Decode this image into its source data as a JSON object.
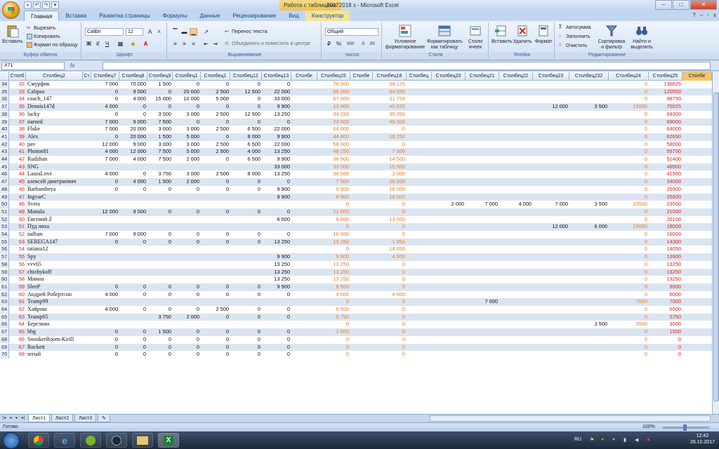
{
  "window": {
    "title": "20172018 з - Microsoft Excel",
    "context_tab_title": "Работа с таблицами",
    "controls": [
      "–",
      "□",
      "✕"
    ]
  },
  "ribbon_tabs": [
    "Главная",
    "Вставка",
    "Разметка страницы",
    "Формулы",
    "Данные",
    "Рецензирование",
    "Вид",
    "Конструктор"
  ],
  "ribbon": {
    "clipboard": {
      "paste": "Вставить",
      "cut": "Вырезать",
      "copy": "Копировать",
      "format_painter": "Формат по образцу",
      "group": "Буфер обмена"
    },
    "font": {
      "name": "Calibri",
      "size": "12",
      "bold": "Ж",
      "italic": "К",
      "underline": "Ч",
      "group": "Шрифт"
    },
    "alignment": {
      "wrap": "Перенос текста",
      "merge": "Объединить и поместить в центре",
      "group": "Выравнивание"
    },
    "number": {
      "format": "Общий",
      "group": "Число",
      "percent": "%",
      "thousands": "000"
    },
    "styles": {
      "conditional": "Условное форматирование",
      "as_table": "Форматировать как таблицу",
      "cell_styles": "Стили ячеек",
      "group": "Стили"
    },
    "cells": {
      "insert": "Вставить",
      "delete": "Удалить",
      "format": "Формат",
      "group": "Ячейки"
    },
    "editing": {
      "autosum": "Автосумма",
      "fill": "Заполнить",
      "clear": "Очистить",
      "sort": "Сортировка и фильтр",
      "find": "Найти и выделить",
      "group": "Редактирование"
    }
  },
  "formula_bar": {
    "name_box": "X71",
    "fx": "fx",
    "content": ""
  },
  "columns": [
    "Столб",
    "Столбец2",
    "Ст",
    "Столбец7",
    "Столбец8",
    "Столбец9",
    "Столбец1",
    "Столбец1",
    "Столбец12",
    "Столбец13",
    "Столбе",
    "Столбец15",
    "Столбе",
    "Столбец18",
    "Столбец",
    "Столбец20",
    "Столбец21",
    "Столбец22",
    "Столбец23",
    "Столбец232",
    "Столбец24",
    "Столбец25",
    "Столбе"
  ],
  "rows": [
    {
      "r": "34",
      "n": "32",
      "name": "Смурфик",
      "c7": "7 000",
      "c8": "70 000",
      "c9": "1 500",
      "c10": "0",
      "c11": "0",
      "c12": "0",
      "c13": "0",
      "c15": "78 500",
      "c18": "58 125",
      "c21": "",
      "c22": "",
      "c23": "",
      "c232": "",
      "c24": "0",
      "c25": "136625"
    },
    {
      "r": "35",
      "n": "33",
      "name": "Calipso",
      "c7": "0",
      "c8": "9 000",
      "c9": "0",
      "c10": "20 000",
      "c11": "2 500",
      "c12": "12 500",
      "c13": "22 000",
      "c15": "66 000",
      "c18": "54 550",
      "c21": "",
      "c22": "",
      "c23": "",
      "c232": "",
      "c24": "0",
      "c25": "120550"
    },
    {
      "r": "36",
      "n": "34",
      "name": "coach_147",
      "c7": "0",
      "c8": "4 000",
      "c9": "15 000",
      "c10": "10 000",
      "c11": "5 000",
      "c12": "0",
      "c13": "33 000",
      "c15": "67 000",
      "c18": "31 750",
      "c21": "",
      "c22": "",
      "c23": "",
      "c232": "",
      "c24": "0",
      "c25": "98750"
    },
    {
      "r": "37",
      "n": "35",
      "name": "Dennis147d",
      "c7": "4 000",
      "c8": "0",
      "c9": "0",
      "c10": "0",
      "c11": "0",
      "c12": "0",
      "c13": "9 900",
      "c15": "13 900",
      "c18": "45 625",
      "c21": "",
      "c22": "",
      "c23": "12 000",
      "c232": "3 500",
      "c24": "15500",
      "c25": "75025"
    },
    {
      "r": "38",
      "n": "36",
      "name": "lucky",
      "c7": "0",
      "c8": "0",
      "c9": "3 000",
      "c10": "3 000",
      "c11": "2 500",
      "c12": "12 500",
      "c13": "13 250",
      "c15": "34 250",
      "c18": "35 050",
      "c21": "",
      "c22": "",
      "c23": "",
      "c232": "",
      "c24": "0",
      "c25": "69300"
    },
    {
      "r": "39",
      "n": "37",
      "name": "narned",
      "c7": "7 000",
      "c8": "9 000",
      "c9": "7 500",
      "c10": "0",
      "c11": "0",
      "c12": "0",
      "c13": "0",
      "c15": "23 500",
      "c18": "45 500",
      "c21": "",
      "c22": "",
      "c23": "",
      "c232": "",
      "c24": "0",
      "c25": "69000"
    },
    {
      "r": "40",
      "n": "38",
      "name": "Fluke",
      "c7": "7 000",
      "c8": "20 000",
      "c9": "3 000",
      "c10": "3 000",
      "c11": "2 500",
      "c12": "6 500",
      "c13": "22 000",
      "c15": "64 000",
      "c18": "0",
      "c21": "",
      "c22": "",
      "c23": "",
      "c232": "",
      "c24": "0",
      "c25": "64000"
    },
    {
      "r": "41",
      "n": "39",
      "name": "Alex",
      "c7": "0",
      "c8": "20 000",
      "c9": "1 500",
      "c10": "5 000",
      "c11": "0",
      "c12": "8 000",
      "c13": "9 900",
      "c15": "44 400",
      "c18": "18 250",
      "c21": "",
      "c22": "",
      "c23": "",
      "c232": "",
      "c24": "0",
      "c25": "62650"
    },
    {
      "r": "42",
      "n": "40",
      "name": "pav",
      "c7": "12 000",
      "c8": "9 000",
      "c9": "3 000",
      "c10": "3 000",
      "c11": "2 500",
      "c12": "6 500",
      "c13": "22 000",
      "c15": "58 000",
      "c18": "0",
      "c21": "",
      "c22": "",
      "c23": "",
      "c232": "",
      "c24": "0",
      "c25": "58000"
    },
    {
      "r": "43",
      "n": "41",
      "name": "Photon81",
      "c7": "4 000",
      "c8": "12 000",
      "c9": "7 500",
      "c10": "5 000",
      "c11": "2 500",
      "c12": "4 000",
      "c13": "13 250",
      "c15": "48 250",
      "c18": "7 500",
      "c21": "",
      "c22": "",
      "c23": "",
      "c232": "",
      "c24": "0",
      "c25": "55750"
    },
    {
      "r": "44",
      "n": "42",
      "name": "Rudzhan",
      "c7": "7 000",
      "c8": "4 000",
      "c9": "7 500",
      "c10": "2 000",
      "c11": "0",
      "c12": "6 500",
      "c13": "9 900",
      "c15": "36 900",
      "c18": "14 500",
      "c21": "",
      "c22": "",
      "c23": "",
      "c232": "",
      "c24": "0",
      "c25": "51400"
    },
    {
      "r": "45",
      "n": "43",
      "name": "SNG",
      "c7": "",
      "c8": "",
      "c9": "",
      "c10": "",
      "c11": "",
      "c12": "",
      "c13": "33 000",
      "c15": "33 000",
      "c18": "15 500",
      "c21": "",
      "c22": "",
      "c23": "",
      "c232": "",
      "c24": "0",
      "c25": "48500"
    },
    {
      "r": "46",
      "n": "44",
      "name": "LauraLove",
      "c7": "4 000",
      "c8": "0",
      "c9": "3 750",
      "c10": "3 000",
      "c11": "2 500",
      "c12": "8 000",
      "c13": "13 250",
      "c15": "38 500",
      "c18": "3 000",
      "c21": "",
      "c22": "",
      "c23": "",
      "c232": "",
      "c24": "0",
      "c25": "41500"
    },
    {
      "r": "47",
      "n": "45",
      "name": "алексей дмитриевич",
      "c7": "0",
      "c8": "4 000",
      "c9": "1 500",
      "c10": "2 000",
      "c11": "0",
      "c12": "0",
      "c13": "0",
      "c15": "7 500",
      "c18": "26 500",
      "c21": "",
      "c22": "",
      "c23": "",
      "c232": "",
      "c24": "0",
      "c25": "34000"
    },
    {
      "r": "48",
      "n": "46",
      "name": "Barbambeya",
      "c7": "0",
      "c8": "0",
      "c9": "0",
      "c10": "0",
      "c11": "0",
      "c12": "0",
      "c13": "9 900",
      "c15": "9 900",
      "c18": "16 000",
      "c21": "",
      "c22": "",
      "c23": "",
      "c232": "",
      "c24": "0",
      "c25": "25900"
    },
    {
      "r": "49",
      "n": "47",
      "name": "IngvarC",
      "c7": "",
      "c8": "",
      "c9": "",
      "c10": "",
      "c11": "",
      "c12": "",
      "c13": "9 900",
      "c15": "9 900",
      "c18": "16 000",
      "c21": "",
      "c22": "",
      "c23": "",
      "c232": "",
      "c24": "0",
      "c25": "25900"
    },
    {
      "r": "50",
      "n": "48",
      "name": "Sveta",
      "c7": "",
      "c8": "",
      "c9": "",
      "c10": "",
      "c11": "",
      "c12": "",
      "c13": "",
      "c15": "0",
      "c18": "0",
      "c20": "2 000",
      "c21": "7 000",
      "c22": "4 000",
      "c23": "7 000",
      "c232": "3 500",
      "c24": "23500",
      "c25": "23500"
    },
    {
      "r": "51",
      "n": "49",
      "name": "Manula",
      "c7": "12 000",
      "c8": "9 000",
      "c9": "0",
      "c10": "0",
      "c11": "0",
      "c12": "0",
      "c13": "0",
      "c15": "21 000",
      "c18": "0",
      "c21": "",
      "c22": "",
      "c23": "",
      "c232": "",
      "c24": "0",
      "c25": "21000"
    },
    {
      "r": "52",
      "n": "50",
      "name": "Евгений Z",
      "c7": "",
      "c8": "",
      "c9": "",
      "c10": "",
      "c11": "",
      "c12": "",
      "c13": "6 600",
      "c15": "6 600",
      "c18": "13 500",
      "c21": "",
      "c22": "",
      "c23": "",
      "c232": "",
      "c24": "0",
      "c25": "20100"
    },
    {
      "r": "53",
      "n": "51",
      "name": "Пуд лиха",
      "c7": "",
      "c8": "",
      "c9": "",
      "c10": "",
      "c11": "",
      "c12": "",
      "c13": "",
      "c15": "0",
      "c18": "0",
      "c21": "",
      "c22": "",
      "c23": "12 000",
      "c232": "6 000",
      "c24": "18000",
      "c25": "18000"
    },
    {
      "r": "54",
      "n": "52",
      "name": "nalban",
      "c7": "7 000",
      "c8": "9 000",
      "c9": "0",
      "c10": "0",
      "c11": "0",
      "c12": "0",
      "c13": "0",
      "c15": "16 000",
      "c18": "0",
      "c21": "",
      "c22": "",
      "c23": "",
      "c232": "",
      "c24": "0",
      "c25": "16000"
    },
    {
      "r": "55",
      "n": "53",
      "name": "SEREGA147",
      "c7": "0",
      "c8": "0",
      "c9": "0",
      "c10": "0",
      "c11": "0",
      "c12": "0",
      "c13": "13 250",
      "c15": "13 250",
      "c18": "1 050",
      "c21": "",
      "c22": "",
      "c23": "",
      "c232": "",
      "c24": "0",
      "c25": "14300"
    },
    {
      "r": "56",
      "n": "54",
      "name": "tatiana12",
      "c7": "",
      "c8": "",
      "c9": "",
      "c10": "",
      "c11": "",
      "c12": "",
      "c13": "",
      "c15": "0",
      "c18": "14 050",
      "c21": "",
      "c22": "",
      "c23": "",
      "c232": "",
      "c24": "0",
      "c25": "14050"
    },
    {
      "r": "57",
      "n": "55",
      "name": "Spy",
      "c7": "",
      "c8": "",
      "c9": "",
      "c10": "",
      "c11": "",
      "c12": "",
      "c13": "9 900",
      "c15": "9 900",
      "c18": "4 000",
      "c21": "",
      "c22": "",
      "c23": "",
      "c232": "",
      "c24": "0",
      "c25": "13900"
    },
    {
      "r": "58",
      "n": "56",
      "name": "vvv65",
      "c7": "",
      "c8": "",
      "c9": "",
      "c10": "",
      "c11": "",
      "c12": "",
      "c13": "13 250",
      "c15": "13 250",
      "c18": "0",
      "c21": "",
      "c22": "",
      "c23": "",
      "c232": "",
      "c24": "0",
      "c25": "13250"
    },
    {
      "r": "59",
      "n": "57",
      "name": "chizhykoff",
      "c7": "",
      "c8": "",
      "c9": "",
      "c10": "",
      "c11": "",
      "c12": "",
      "c13": "13 250",
      "c15": "13 250",
      "c18": "0",
      "c21": "",
      "c22": "",
      "c23": "",
      "c232": "",
      "c24": "0",
      "c25": "13250"
    },
    {
      "r": "60",
      "n": "58",
      "name": "Минна",
      "c7": "",
      "c8": "",
      "c9": "",
      "c10": "",
      "c11": "",
      "c12": "",
      "c13": "13 250",
      "c15": "13 250",
      "c18": "0",
      "c21": "",
      "c22": "",
      "c23": "",
      "c232": "",
      "c24": "0",
      "c25": "13250"
    },
    {
      "r": "61",
      "n": "59",
      "name": "SleeP",
      "c7": "0",
      "c8": "0",
      "c9": "0",
      "c10": "0",
      "c11": "0",
      "c12": "0",
      "c13": "9 900",
      "c15": "9 900",
      "c18": "0",
      "c21": "",
      "c22": "",
      "c23": "",
      "c232": "",
      "c24": "0",
      "c25": "9900"
    },
    {
      "r": "62",
      "n": "60",
      "name": "Андрей Робертсон",
      "c7": "4 000",
      "c8": "0",
      "c9": "0",
      "c10": "0",
      "c11": "0",
      "c12": "0",
      "c13": "0",
      "c15": "4 000",
      "c18": "4 000",
      "c21": "",
      "c22": "",
      "c23": "",
      "c232": "",
      "c24": "0",
      "c25": "8000"
    },
    {
      "r": "63",
      "n": "61",
      "name": "Trump99",
      "c7": "",
      "c8": "",
      "c9": "",
      "c10": "",
      "c11": "",
      "c12": "",
      "c13": "",
      "c15": "0",
      "c18": "0",
      "c21": "7 000",
      "c22": "",
      "c23": "",
      "c232": "",
      "c24": "7000",
      "c25": "7000"
    },
    {
      "r": "64",
      "n": "62",
      "name": "Хайрош",
      "c7": "4 000",
      "c8": "0",
      "c9": "0",
      "c10": "0",
      "c11": "2 500",
      "c12": "0",
      "c13": "0",
      "c15": "6 500",
      "c18": "0",
      "c21": "",
      "c22": "",
      "c23": "",
      "c232": "",
      "c24": "0",
      "c25": "6500"
    },
    {
      "r": "65",
      "n": "63",
      "name": "Trump05",
      "c7": "",
      "c8": "",
      "c9": "3 750",
      "c10": "2 000",
      "c11": "0",
      "c12": "0",
      "c13": "0",
      "c15": "5 750",
      "c18": "0",
      "c21": "",
      "c22": "",
      "c23": "",
      "c232": "",
      "c24": "0",
      "c25": "5750"
    },
    {
      "r": "66",
      "n": "64",
      "name": "Березкин",
      "c7": "",
      "c8": "",
      "c9": "",
      "c10": "",
      "c11": "",
      "c12": "",
      "c13": "",
      "c15": "0",
      "c18": "0",
      "c21": "",
      "c22": "",
      "c23": "",
      "c232": "3 500",
      "c24": "3500",
      "c25": "3500"
    },
    {
      "r": "67",
      "n": "65",
      "name": "bbg",
      "c7": "0",
      "c8": "0",
      "c9": "1 500",
      "c10": "0",
      "c11": "0",
      "c12": "0",
      "c13": "0",
      "c15": "1 500",
      "c18": "0",
      "c21": "",
      "c22": "",
      "c23": "",
      "c232": "",
      "c24": "0",
      "c25": "1500"
    },
    {
      "r": "68",
      "n": "66",
      "name": "SnookerRoom-Kirill",
      "c7": "0",
      "c8": "0",
      "c9": "0",
      "c10": "0",
      "c11": "0",
      "c12": "0",
      "c13": "0",
      "c15": "0",
      "c18": "0",
      "c21": "",
      "c22": "",
      "c23": "",
      "c232": "",
      "c24": "0",
      "c25": "0"
    },
    {
      "r": "69",
      "n": "67",
      "name": "Rockett",
      "c7": "0",
      "c8": "0",
      "c9": "0",
      "c10": "0",
      "c11": "0",
      "c12": "0",
      "c13": "0",
      "c15": "0",
      "c18": "0",
      "c21": "",
      "c22": "",
      "c23": "",
      "c232": "",
      "c24": "0",
      "c25": "0"
    },
    {
      "r": "70",
      "n": "68",
      "name": "serый",
      "c7": "0",
      "c8": "0",
      "c9": "0",
      "c10": "0",
      "c11": "0",
      "c12": "0",
      "c13": "0",
      "c15": "0",
      "c18": "0",
      "c21": "",
      "c22": "",
      "c23": "",
      "c232": "",
      "c24": "0",
      "c25": "0"
    }
  ],
  "sheets": [
    "Лист1",
    "Лист2",
    "Лист3"
  ],
  "status": {
    "text": "Готово",
    "zoom": "100%"
  },
  "taskbar": {
    "lang": "RU",
    "time": "12:42",
    "date": "26.10.2017"
  },
  "colors": {
    "red": "#e02020",
    "orange": "#ea7a1e",
    "selected_header": "#f6c46a",
    "row_band": "#dbe5f1"
  }
}
